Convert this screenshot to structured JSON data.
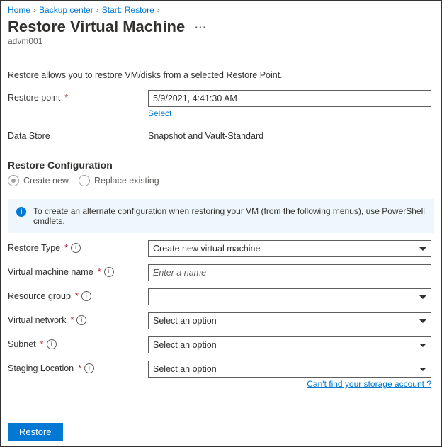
{
  "breadcrumb": {
    "home": "Home",
    "backup_center": "Backup center",
    "start_restore": "Start: Restore"
  },
  "header": {
    "title": "Restore Virtual Machine",
    "subtitle": "advm001"
  },
  "intro": "Restore allows you to restore VM/disks from a selected Restore Point.",
  "restore_point": {
    "label": "Restore point",
    "value": "5/9/2021, 4:41:30 AM",
    "select_link": "Select"
  },
  "data_store": {
    "label": "Data Store",
    "value": "Snapshot and Vault-Standard"
  },
  "restore_config_header": "Restore Configuration",
  "radio": {
    "create_new": "Create new",
    "replace_existing": "Replace existing"
  },
  "info_banner": "To create an alternate configuration when restoring your VM (from the following menus), use PowerShell cmdlets.",
  "fields": {
    "restore_type": {
      "label": "Restore Type",
      "value": "Create new virtual machine"
    },
    "vm_name": {
      "label": "Virtual machine name",
      "placeholder": "Enter a name"
    },
    "resource_group": {
      "label": "Resource group",
      "value": ""
    },
    "vnet": {
      "label": "Virtual network",
      "value": "Select an option"
    },
    "subnet": {
      "label": "Subnet",
      "value": "Select an option"
    },
    "staging": {
      "label": "Staging Location",
      "value": "Select an option"
    }
  },
  "help_link": "Can't find your storage account ?",
  "footer": {
    "restore_btn": "Restore"
  }
}
